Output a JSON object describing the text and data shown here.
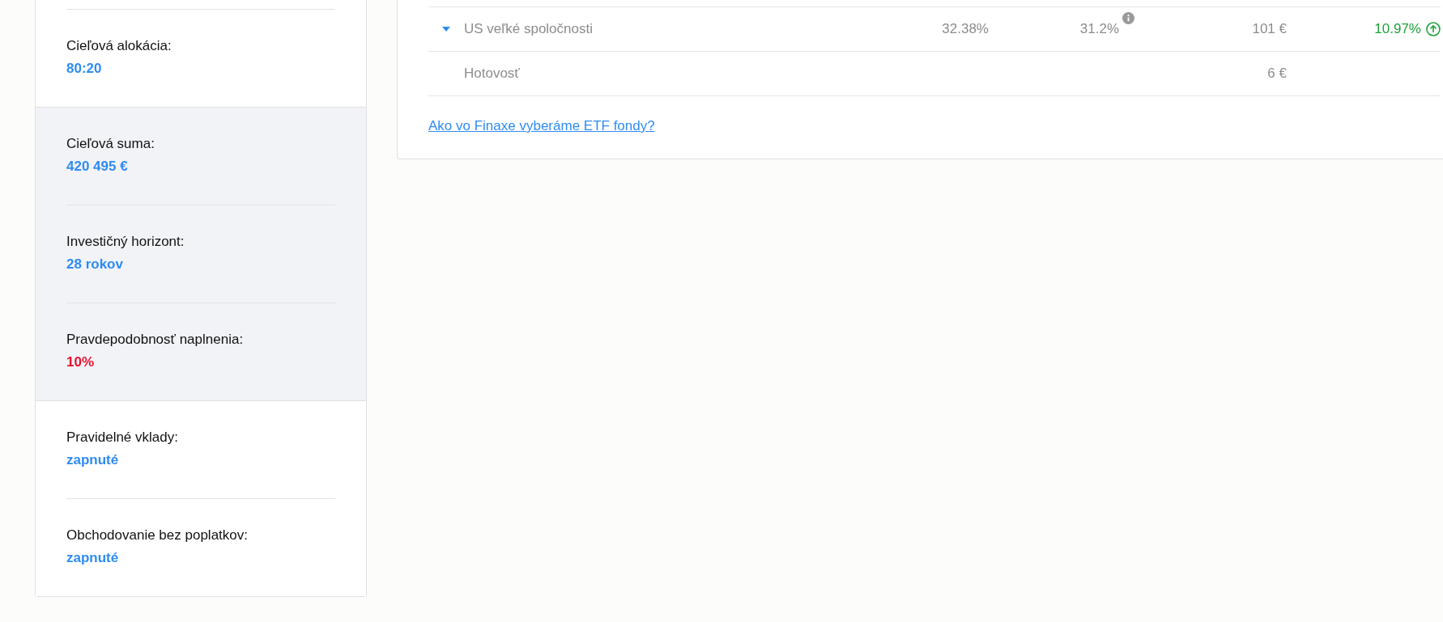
{
  "summary_sections": [
    {
      "shaded": false,
      "items": [
        {
          "label": "Cieľová alokácia:",
          "value": "80:20",
          "alert": false
        }
      ]
    },
    {
      "shaded": true,
      "items": [
        {
          "label": "Cieľová suma:",
          "value": "420 495 €",
          "alert": false
        },
        {
          "label": "Investičný horizont:",
          "value": "28 rokov",
          "alert": false
        },
        {
          "label": "Pravdepodobnosť naplnenia:",
          "value": "10%",
          "alert": true
        }
      ]
    },
    {
      "shaded": false,
      "items": [
        {
          "label": "Pravidelné vklady:",
          "value": "zapnuté",
          "alert": false
        },
        {
          "label": "Obchodovanie bez poplatkov:",
          "value": "zapnuté",
          "alert": false
        }
      ]
    }
  ],
  "portfolio_table": {
    "rows": [
      {
        "expanded": false,
        "name": "US veľké spoločnosti",
        "target_share": "32.38%",
        "actual_share": "31.2%",
        "amount": "101 €",
        "return": "10.97%"
      },
      {
        "name": "Hotovosť",
        "amount": "6 €"
      }
    ]
  },
  "etf_link": "Ako vo Finaxe vyberáme ETF fondy?"
}
